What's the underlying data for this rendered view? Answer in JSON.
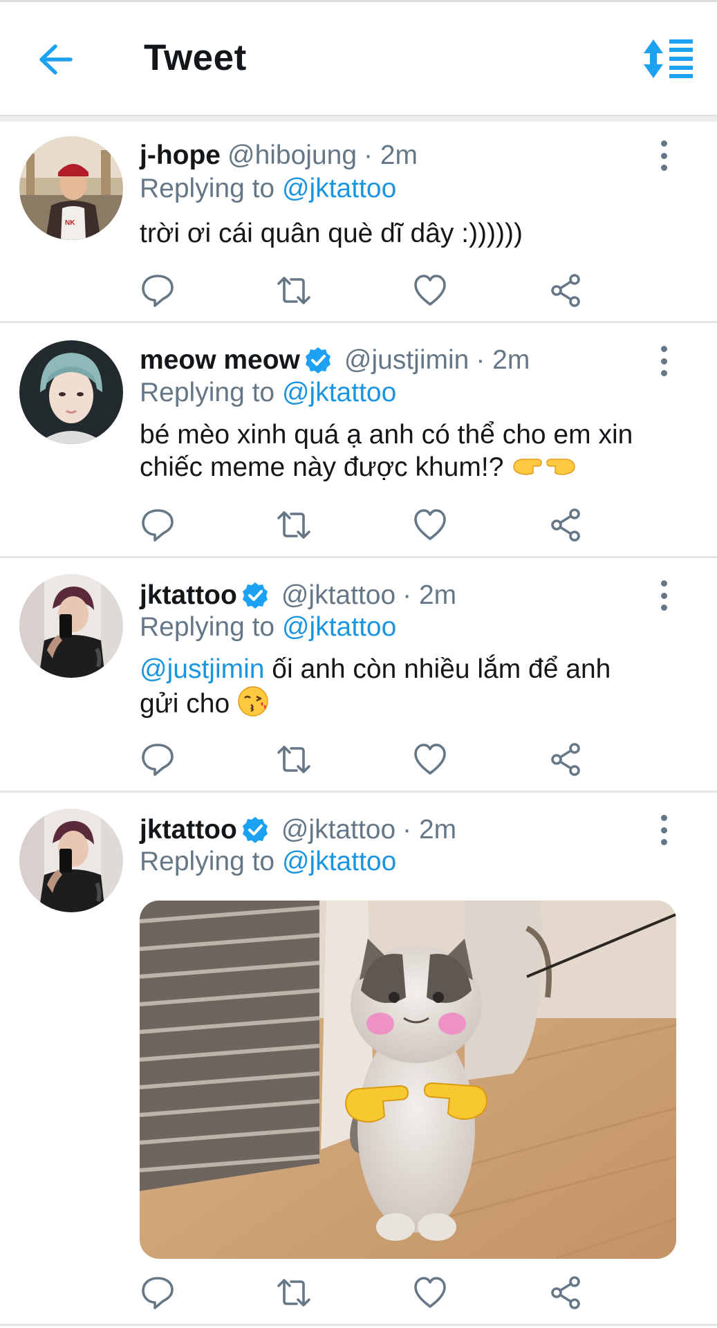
{
  "header": {
    "title": "Tweet",
    "accent": "#1da1f2"
  },
  "tweets": [
    {
      "display_name": "j-hope",
      "verified": false,
      "handle": "@hibojung",
      "time": "· 2m",
      "replying_prefix": "Replying to",
      "replying_to": "@jktattoo",
      "text": "trời ơi cái quân què dĩ dây :))))))"
    },
    {
      "display_name": "meow meow",
      "verified": true,
      "handle": "@justjimin",
      "time": "· 2m",
      "replying_prefix": "Replying to",
      "replying_to": "@jktattoo",
      "text_line1": "bé mèo xinh quá ạ anh có thể cho em xin",
      "text_line2": "chiếc meme này được khum!?"
    },
    {
      "display_name": "jktattoo",
      "verified": true,
      "handle": "@jktattoo",
      "time": "· 2m",
      "replying_prefix": "Replying to",
      "replying_to": "@jktattoo",
      "mention": "@justjimin",
      "text_line1": " ối anh còn nhiều lắm để anh",
      "text_line2": "gửi cho"
    },
    {
      "display_name": "jktattoo",
      "verified": true,
      "handle": "@jktattoo",
      "time": "· 2m",
      "replying_prefix": "Replying to",
      "replying_to": "@jktattoo",
      "media": "cat-meme-photo"
    }
  ],
  "icons": {
    "back": "arrow-left-icon",
    "sort": "sort-icon",
    "reply": "reply-icon",
    "retweet": "retweet-icon",
    "like": "heart-icon",
    "share": "share-icon",
    "more": "more-vertical-icon",
    "verified": "verified-badge-icon"
  },
  "colors": {
    "link": "#1b95e0",
    "secondary_text": "#657786",
    "verified": "#1da1f2"
  }
}
